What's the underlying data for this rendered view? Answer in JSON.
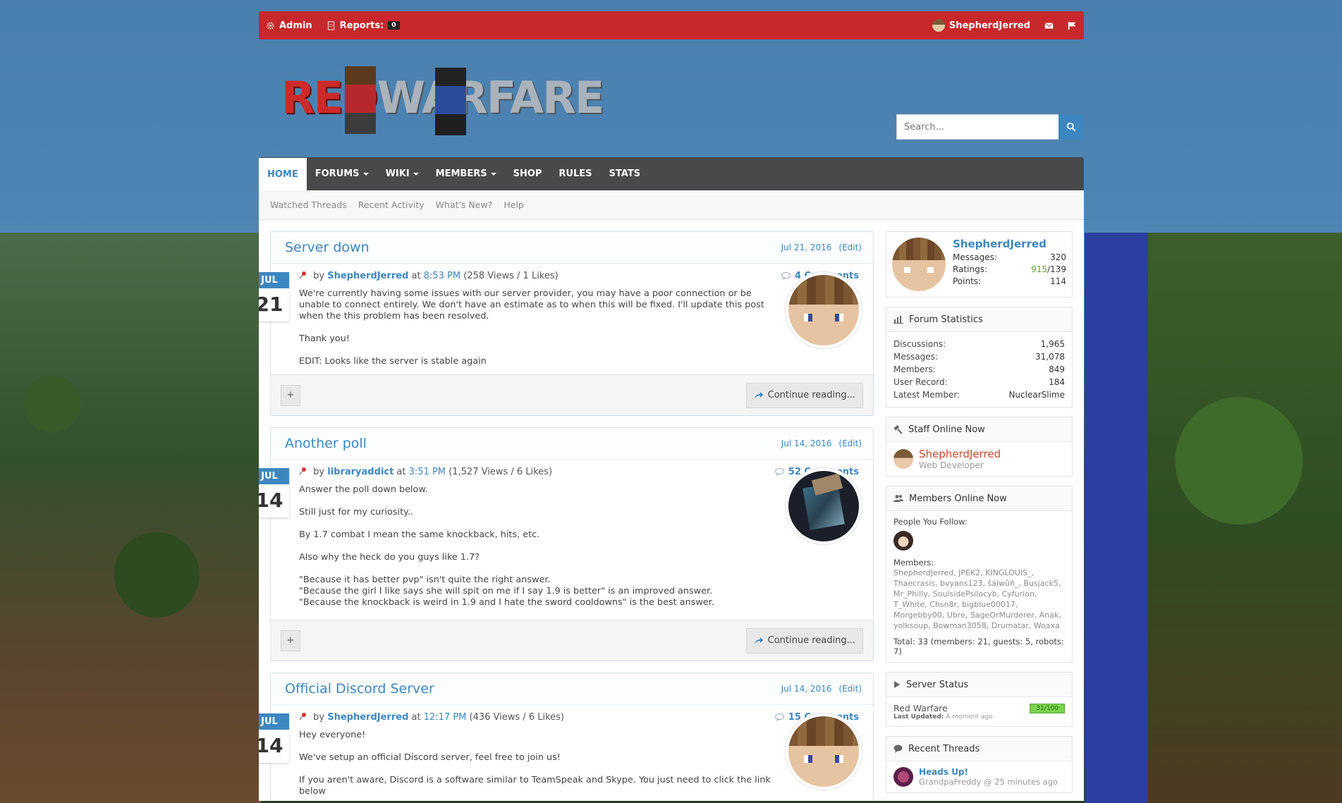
{
  "colors": {
    "accent": "#3d87c0",
    "admin_bar": "#c7282b",
    "nav": "#49494b"
  },
  "adminbar": {
    "admin_label": "Admin",
    "reports_label": "Reports:",
    "reports_count": "0",
    "username": "ShepherdJerred"
  },
  "logo": {
    "part1": "RED",
    "part2": "WARFARE"
  },
  "search": {
    "placeholder": "Search..."
  },
  "nav": {
    "items": [
      {
        "label": "HOME"
      },
      {
        "label": "FORUMS"
      },
      {
        "label": "WIKI"
      },
      {
        "label": "MEMBERS"
      },
      {
        "label": "SHOP"
      },
      {
        "label": "RULES"
      },
      {
        "label": "STATS"
      }
    ],
    "sub": [
      "Watched Threads",
      "Recent Activity",
      "What's New?",
      "Help"
    ]
  },
  "posts": [
    {
      "title": "Server down",
      "date": "Jul 21, 2016",
      "edit": "(Edit)",
      "month": "JUL",
      "day": "21",
      "by": "by",
      "author": "ShepherdJerred",
      "at": "at",
      "time": "8:53 PM",
      "stats": "(258 Views / 1 Likes)",
      "comments": "4 Comments",
      "paragraphs": [
        "We're currently having some issues with our server provider, you may have a poor connection or be unable to connect entirely. We don't have an estimate as to when this will be fixed. I'll update this post when the this problem has been resolved.",
        "Thank you!",
        "EDIT: Looks like the server is stable again"
      ],
      "plus": "+",
      "continue": "Continue reading..."
    },
    {
      "title": "Another poll",
      "date": "Jul 14, 2016",
      "edit": "(Edit)",
      "month": "JUL",
      "day": "14",
      "by": "by",
      "author": "libraryaddict",
      "at": "at",
      "time": "3:51 PM",
      "stats": "(1,527 Views / 6 Likes)",
      "comments": "52 Comments",
      "paragraphs": [
        "Answer the poll down below.",
        "Still just for my curiosity..",
        "By 1.7 combat I mean the same knockback, hits, etc.",
        "Also why the heck do you guys like 1.7?",
        "\"Because it has better pvp\" isn't quite the right answer.",
        "\"Because the girl I like says she will spit on me if I say 1.9 is better\" is an improved answer.",
        "\"Because the knockback is weird in 1.9 and I hate the sword cooldowns\" is the best answer."
      ],
      "plus": "+",
      "continue": "Continue reading..."
    },
    {
      "title": "Official Discord Server",
      "date": "Jul 14, 2016",
      "edit": "(Edit)",
      "month": "JUL",
      "day": "14",
      "by": "by",
      "author": "ShepherdJerred",
      "at": "at",
      "time": "12:17 PM",
      "stats": "(436 Views / 6 Likes)",
      "comments": "15 Comments",
      "paragraphs": [
        "Hey everyone!",
        "We've setup an official Discord server, feel free to join us!",
        "If you aren't aware, Discord is a software similar to TeamSpeak and Skype. You just need to click the link below"
      ]
    }
  ],
  "sidebar": {
    "user": {
      "name": "ShepherdJerred",
      "messages_label": "Messages:",
      "messages": "320",
      "ratings_label": "Ratings:",
      "ratings_pos": "915",
      "ratings_rest": "/139",
      "points_label": "Points:",
      "points": "114"
    },
    "forum_stats": {
      "title": "Forum Statistics",
      "rows": [
        {
          "k": "Discussions:",
          "v": "1,965"
        },
        {
          "k": "Messages:",
          "v": "31,078"
        },
        {
          "k": "Members:",
          "v": "849"
        },
        {
          "k": "User Record:",
          "v": "184"
        },
        {
          "k": "Latest Member:",
          "v": "NuclearSlime"
        }
      ]
    },
    "staff": {
      "title": "Staff Online Now",
      "name": "ShepherdJerred",
      "role": "Web Developer"
    },
    "members_online": {
      "title": "Members Online Now",
      "follow_label": "People You Follow:",
      "members_label": "Members:",
      "list": "ShepherdJerred, JPEK2, KINGLOUIS_, Thaecrasis, bvyans123, šálwûñ_, Busjack5, Mr_Philly, SoulsidePsilocyb, Cyfurion, T_White, Chsn8r, bigblue00017, Morgebby00, Ubre, SageOrMurderer, Anak, yolksoup, Bowman3058, Drumatar, Woaxa",
      "total": "Total: 33 (members: 21, guests: 5, robots: 7)"
    },
    "server_status": {
      "title": "Server Status",
      "server": "Red Warfare",
      "updated_label": "Last Updated:",
      "updated": "A moment ago",
      "players": "31/100"
    },
    "recent_threads": {
      "title": "Recent Threads",
      "thread_title": "Heads Up!",
      "thread_meta": "GrandpaFreddy @ 25 minutes ago"
    }
  }
}
